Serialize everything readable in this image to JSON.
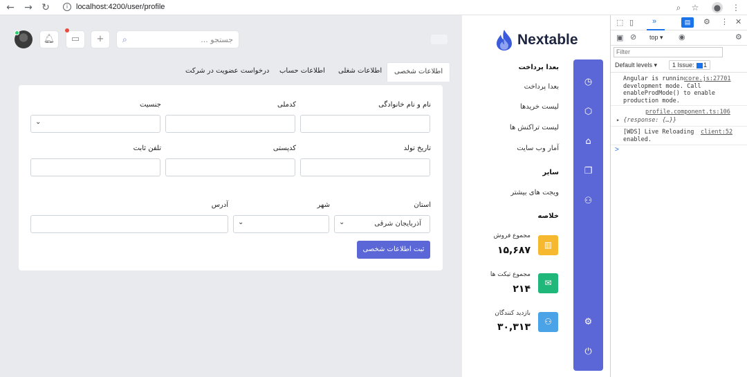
{
  "browser": {
    "url": "localhost:4200/user/profile"
  },
  "topbar": {
    "search_placeholder": "جستجو ..."
  },
  "tabs": [
    {
      "label": "اطلاعات شخصی",
      "active": true
    },
    {
      "label": "اطلاعات شغلی",
      "active": false
    },
    {
      "label": "اطلاعات حساب",
      "active": false
    },
    {
      "label": "درخواست عضویت در شرکت",
      "active": false
    }
  ],
  "form": {
    "full_name_label": "نام و نام خانوادگی",
    "national_code_label": "کدملی",
    "gender_label": "جنسیت",
    "birth_date_label": "تاریخ تولد",
    "postal_code_label": "کدپستی",
    "phone_label": "تلفن ثابت",
    "province_label": "استان",
    "city_label": "شهر",
    "address_label": "آدرس",
    "province_value": "آذربایجان شرقی",
    "submit_label": "ثبت اطلاعات شخصی"
  },
  "sidebar": {
    "brand": "Nextable",
    "section_payment": "بعدا پرداخت",
    "items_payment": [
      "بعدا پرداخت",
      "لیست خریدها",
      "لیست تراکنش ها",
      "آمار وب سایت"
    ],
    "section_other": "سایر",
    "items_other": [
      "ویجت های بیشتر"
    ],
    "section_summary": "خلاصه",
    "stats": [
      {
        "label": "مجموع فروش",
        "value": "۱۵,۶۸۷",
        "color": "#f5b82e",
        "icon": "chart-icon"
      },
      {
        "label": "مجموع تیکت ها",
        "value": "۲۱۴",
        "color": "#20b77a",
        "icon": "mail-icon"
      },
      {
        "label": "بازدید کنندگان",
        "value": "۳۰,۳۱۳",
        "color": "#4aa3e6",
        "icon": "user-icon"
      }
    ]
  },
  "devtools": {
    "context": "top",
    "filter_placeholder": "Filter",
    "levels_label": "Default levels",
    "issue_label": "1 Issue:",
    "issue_count": "1",
    "messages": [
      {
        "text": "Angular is running in development mode. Call enableProdMode() to enable production mode.",
        "link": "core.js:27701"
      },
      {
        "link": "profile.component.ts:106",
        "text": "{response: {…}}"
      },
      {
        "text": "[WDS] Live Reloading enabled.",
        "link": "client:52"
      }
    ],
    "prompt": ">"
  }
}
